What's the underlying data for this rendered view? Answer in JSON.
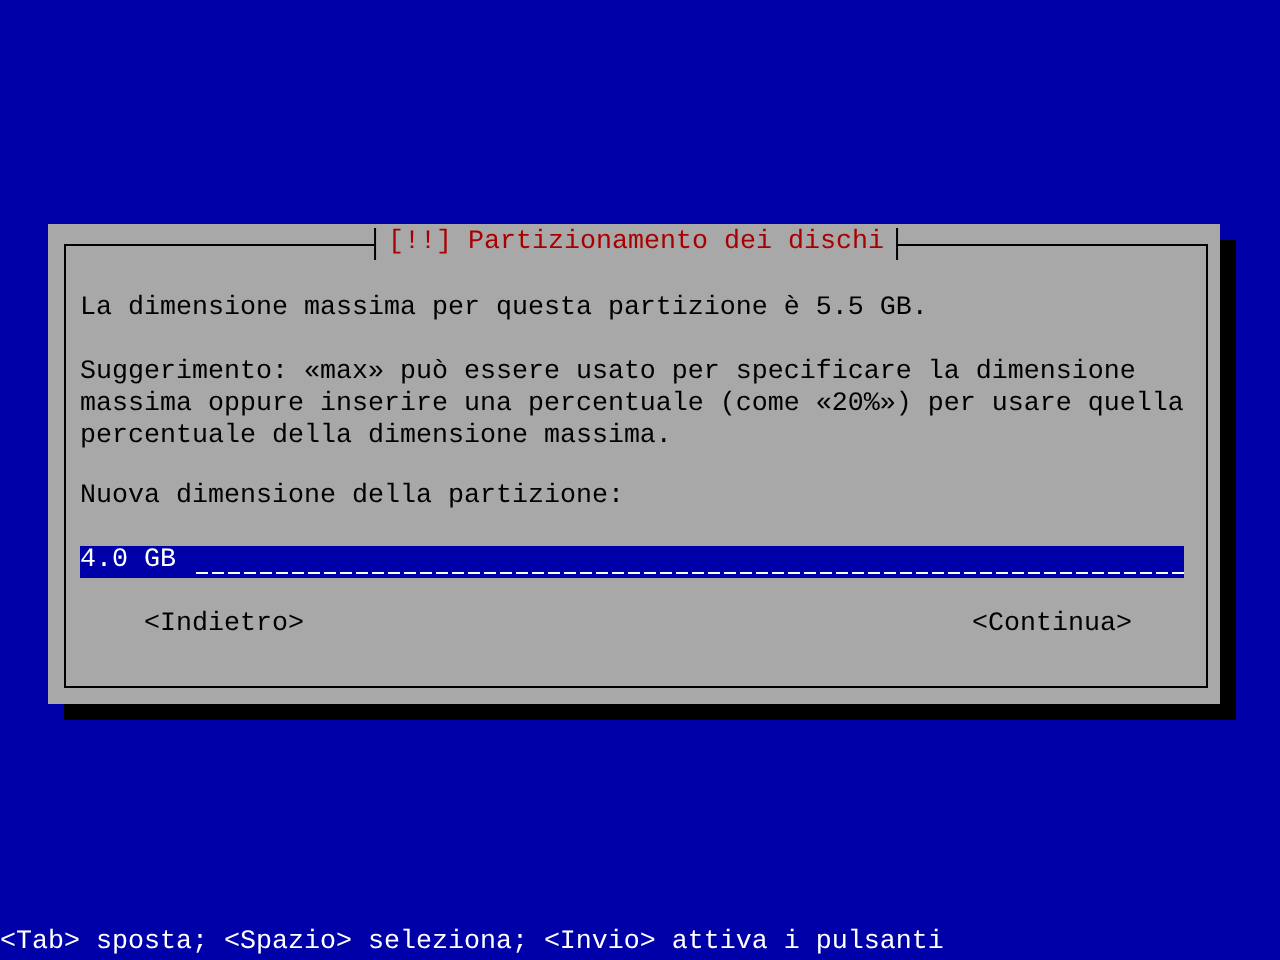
{
  "dialog": {
    "title": "[!!] Partizionamento dei dischi",
    "message": "La dimensione massima per questa partizione è 5.5 GB.",
    "hint": "Suggerimento: «max» può essere usato per specificare la dimensione massima oppure inserire una percentuale (come «20%») per usare quella percentuale della dimensione massima.",
    "prompt": "Nuova dimensione della partizione:",
    "field": {
      "value": "4.0 GB"
    },
    "buttons": [
      {
        "label": "<Indietro>"
      },
      {
        "label": "<Continua>"
      }
    ]
  },
  "status_bar": "<Tab> sposta; <Spazio> seleziona; <Invio> attiva i pulsanti"
}
